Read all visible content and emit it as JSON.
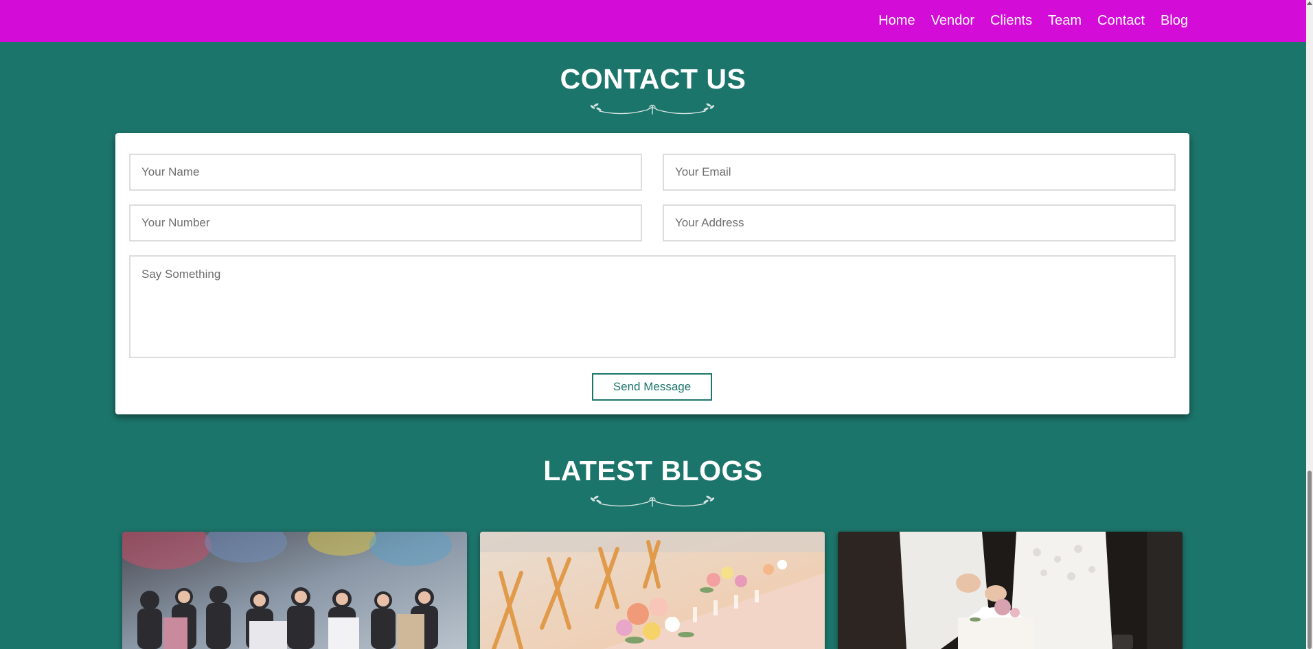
{
  "nav": {
    "items": [
      {
        "label": "Home"
      },
      {
        "label": "Vendor"
      },
      {
        "label": "Clients"
      },
      {
        "label": "Team"
      },
      {
        "label": "Contact"
      },
      {
        "label": "Blog"
      }
    ]
  },
  "contact": {
    "title": "CONTACT US",
    "name_placeholder": "Your Name",
    "email_placeholder": "Your Email",
    "number_placeholder": "Your Number",
    "address_placeholder": "Your Address",
    "message_placeholder": "Say Something",
    "send_label": "Send Message"
  },
  "blogs": {
    "title": "LATEST BLOGS",
    "cards": [
      {
        "image": "party-group-photo"
      },
      {
        "image": "floral-table-setting"
      },
      {
        "image": "wedding-cake-cutting"
      }
    ]
  },
  "colors": {
    "nav_bg": "#d40cd7",
    "page_bg": "#1c756b",
    "accent": "#1c756b"
  }
}
